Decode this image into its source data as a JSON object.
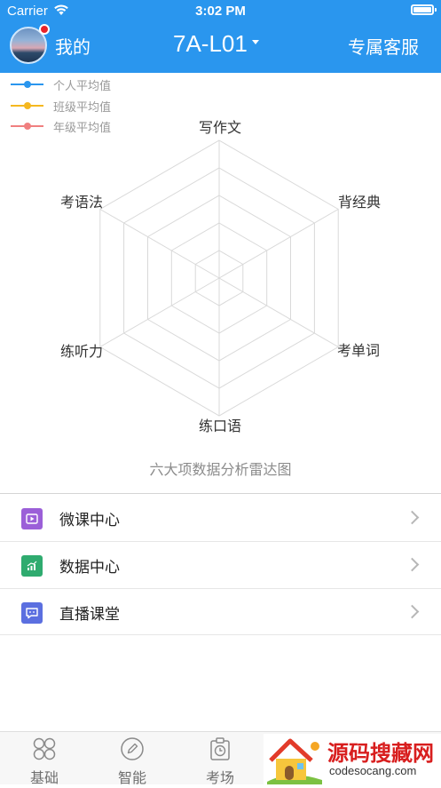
{
  "status_bar": {
    "carrier": "Carrier",
    "time": "3:02 PM"
  },
  "header": {
    "me_label": "我的",
    "class_name": "7A-L01",
    "service_label": "专属客服",
    "bg_color": "#2a96ee",
    "has_notification_dot": true
  },
  "legend": [
    {
      "label": "个人平均值",
      "color": "#2a96ee"
    },
    {
      "label": "班级平均值",
      "color": "#f5b820"
    },
    {
      "label": "年级平均值",
      "color": "#f08080"
    }
  ],
  "radar": {
    "axes": [
      "写作文",
      "背经典",
      "考单词",
      "练口语",
      "练听力",
      "考语法"
    ],
    "rings": 5,
    "caption": "六大项数据分析雷达图"
  },
  "menu": {
    "items": [
      {
        "label": "微课中心",
        "icon": "video-play-icon",
        "color": "#9b5fd8"
      },
      {
        "label": "数据中心",
        "icon": "bar-chart-icon",
        "color": "#2fab6f"
      },
      {
        "label": "直播课堂",
        "icon": "live-chat-icon",
        "color": "#5b6fe0"
      }
    ]
  },
  "tabs": [
    {
      "label": "基础",
      "icon": "grid-circles-icon"
    },
    {
      "label": "智能",
      "icon": "pencil-circle-icon"
    },
    {
      "label": "考场",
      "icon": "clock-board-icon"
    }
  ],
  "watermark": {
    "title": "源码搜藏网",
    "url": "codesocang.com"
  }
}
